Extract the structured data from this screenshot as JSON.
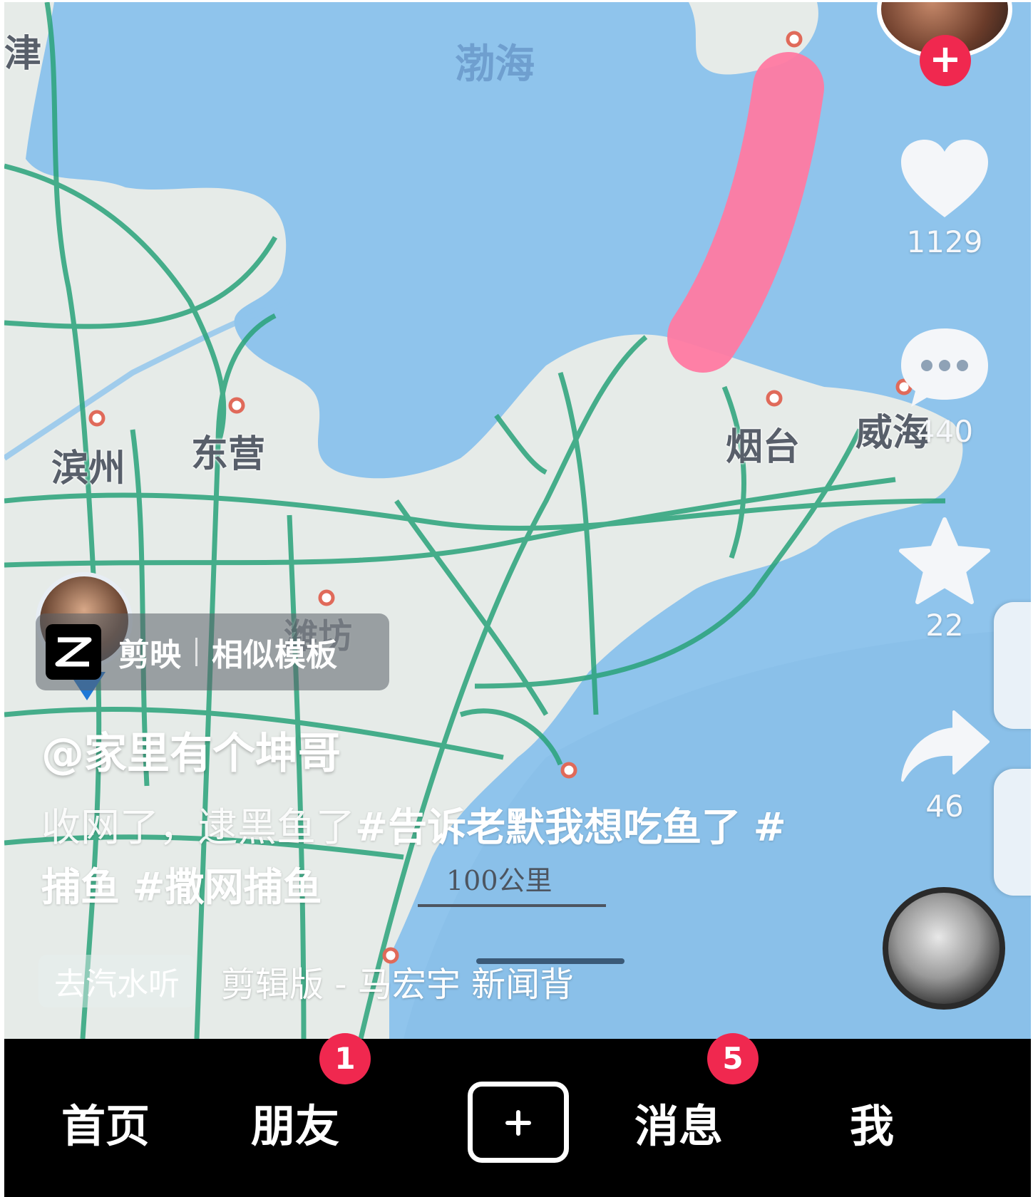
{
  "map": {
    "sea_label": "渤海",
    "cities": [
      {
        "name": "滨州",
        "id": "binzhou"
      },
      {
        "name": "东营",
        "id": "dongying"
      },
      {
        "name": "烟台",
        "id": "yantai"
      },
      {
        "name": "威海",
        "id": "weihai"
      },
      {
        "name": "潍坊",
        "id": "weifang"
      },
      {
        "name": "津",
        "id": "tianjin"
      }
    ],
    "scale_label": "100公里",
    "route_color": "#ff7aa2",
    "highway_color": "#2aa37a",
    "land_color": "#e6ebe8",
    "sea_color": "#8fc4ec"
  },
  "actions": {
    "like_count": "1129",
    "comment_count": "440",
    "favorite_count": "22",
    "share_count": "46",
    "follow_icon": "plus-icon"
  },
  "template_chip": {
    "app_name": "剪映",
    "label": "相似模板"
  },
  "post": {
    "username": "@家里有个坤哥",
    "caption_text": "收网了，逮黑鱼了",
    "hashtags": [
      "#告诉老默我想吃鱼了",
      "#捕鱼",
      "#撒网捕鱼"
    ]
  },
  "music": {
    "pill": "去汽水听",
    "title": "剪辑版 - 马宏宇    新闻背"
  },
  "nav": {
    "home": "首页",
    "friends": "朋友",
    "friends_badge": "1",
    "messages": "消息",
    "messages_badge": "5",
    "me": "我",
    "accent": "#f0284f"
  }
}
